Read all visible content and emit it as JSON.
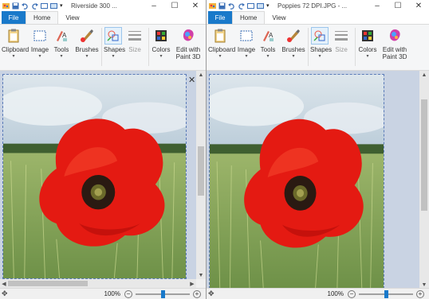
{
  "colors": {
    "accent": "#1979ca",
    "canvas_bg": "#c9d3e3",
    "poppy": "#e41a12"
  },
  "windows": [
    {
      "title": "Riverside 300 ...",
      "controls": [
        "–",
        "☐",
        "✕"
      ],
      "tabs": [
        "File",
        "Home",
        "View"
      ],
      "ribbon": [
        {
          "label": "Clipboard",
          "icon": "clipboard-icon"
        },
        {
          "label": "Image",
          "icon": "image-select-icon"
        },
        {
          "label": "Tools",
          "icon": "tools-icon"
        },
        {
          "label": "Brushes",
          "icon": "brush-icon"
        },
        {
          "label": "Shapes",
          "icon": "shapes-icon"
        },
        {
          "label": "Size",
          "icon": "size-icon"
        },
        {
          "label": "Colors",
          "icon": "colors-icon"
        },
        {
          "label": "Edit with",
          "label2": "Paint 3D",
          "icon": "paint3d-icon"
        }
      ],
      "zoom": "100%",
      "zoom_level": 0.5
    },
    {
      "title": "Poppies 72 DPI.JPG - ...",
      "controls": [
        "–",
        "☐",
        "✕"
      ],
      "tabs": [
        "File",
        "Home",
        "View"
      ],
      "ribbon": [
        {
          "label": "Clipboard",
          "icon": "clipboard-icon"
        },
        {
          "label": "Image",
          "icon": "image-select-icon"
        },
        {
          "label": "Tools",
          "icon": "tools-icon"
        },
        {
          "label": "Brushes",
          "icon": "brush-icon"
        },
        {
          "label": "Shapes",
          "icon": "shapes-icon"
        },
        {
          "label": "Size",
          "icon": "size-icon"
        },
        {
          "label": "Colors",
          "icon": "colors-icon"
        },
        {
          "label": "Edit with",
          "label2": "Paint 3D",
          "icon": "paint3d-icon"
        }
      ],
      "zoom": "100%",
      "zoom_level": 0.5
    }
  ],
  "overlay_close": "✕",
  "glyphs": {
    "chevron": "▾",
    "minus": "−",
    "plus": "+",
    "move": "✥",
    "up": "▲",
    "down": "▼",
    "left": "◀",
    "right": "▶"
  }
}
